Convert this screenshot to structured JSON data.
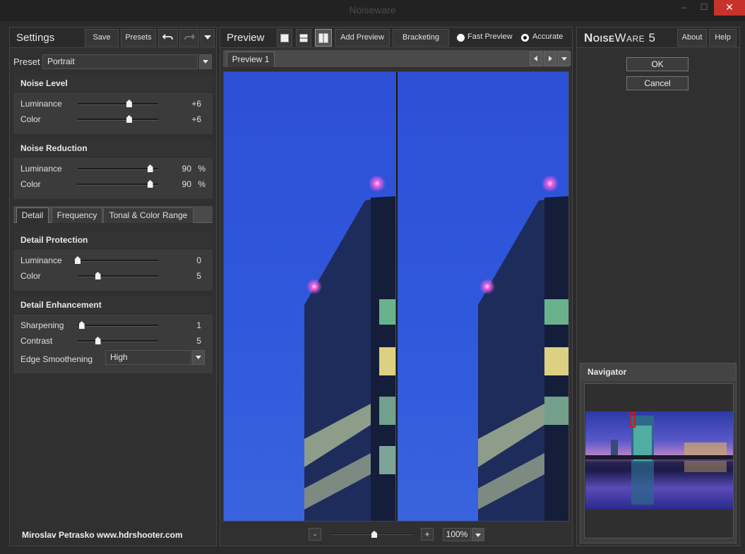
{
  "window": {
    "title": "Noiseware",
    "min": "–",
    "max": "☐",
    "close": "✕"
  },
  "left": {
    "header": {
      "title": "Settings",
      "save": "Save",
      "presets": "Presets"
    },
    "preset": {
      "label": "Preset",
      "value": "Portrait"
    },
    "noise_level": {
      "title": "Noise Level",
      "rows": [
        {
          "label": "Luminance",
          "value": "+6",
          "level": 0.64
        },
        {
          "label": "Color",
          "value": "+6",
          "level": 0.64
        }
      ]
    },
    "noise_reduction": {
      "title": "Noise Reduction",
      "rows": [
        {
          "label": "Luminance",
          "value": "90",
          "unit": "%",
          "level": 0.9
        },
        {
          "label": "Color",
          "value": "90",
          "unit": "%",
          "level": 0.9
        }
      ]
    },
    "tabs": [
      "Detail",
      "Frequency",
      "Tonal & Color Range"
    ],
    "detail_protection": {
      "title": "Detail Protection",
      "rows": [
        {
          "label": "Luminance",
          "value": "0",
          "level": 0.0
        },
        {
          "label": "Color",
          "value": "5",
          "level": 0.25
        }
      ]
    },
    "detail_enhancement": {
      "title": "Detail Enhancement",
      "rows": [
        {
          "label": "Sharpening",
          "value": "1",
          "level": 0.05
        },
        {
          "label": "Contrast",
          "value": "5",
          "level": 0.25
        }
      ],
      "edge": {
        "label": "Edge Smoothening",
        "value": "High"
      }
    },
    "credit": "Miroslav  Petrasko  www.hdrshooter.com"
  },
  "center": {
    "header": {
      "title": "Preview",
      "add_preview": "Add Preview",
      "bracketing": "Bracketing",
      "fast_preview": "Fast Preview",
      "accurate": "Accurate",
      "selected_mode": "accurate"
    },
    "tab": "Preview 1",
    "zoom": {
      "minus": "-",
      "plus": "+",
      "value": "100%",
      "level": 0.5
    }
  },
  "right": {
    "logo_big1": "N",
    "logo_small1": "OISE",
    "logo_big2": "W",
    "logo_small2": "ARE",
    "logo_ver": "5",
    "about": "About",
    "help": "Help",
    "ok": "OK",
    "cancel": "Cancel",
    "navigator": "Navigator"
  },
  "colors": {
    "close_red": "#c7332b",
    "sky_blue": "#2f58dc",
    "nav_box": "#e01010"
  }
}
